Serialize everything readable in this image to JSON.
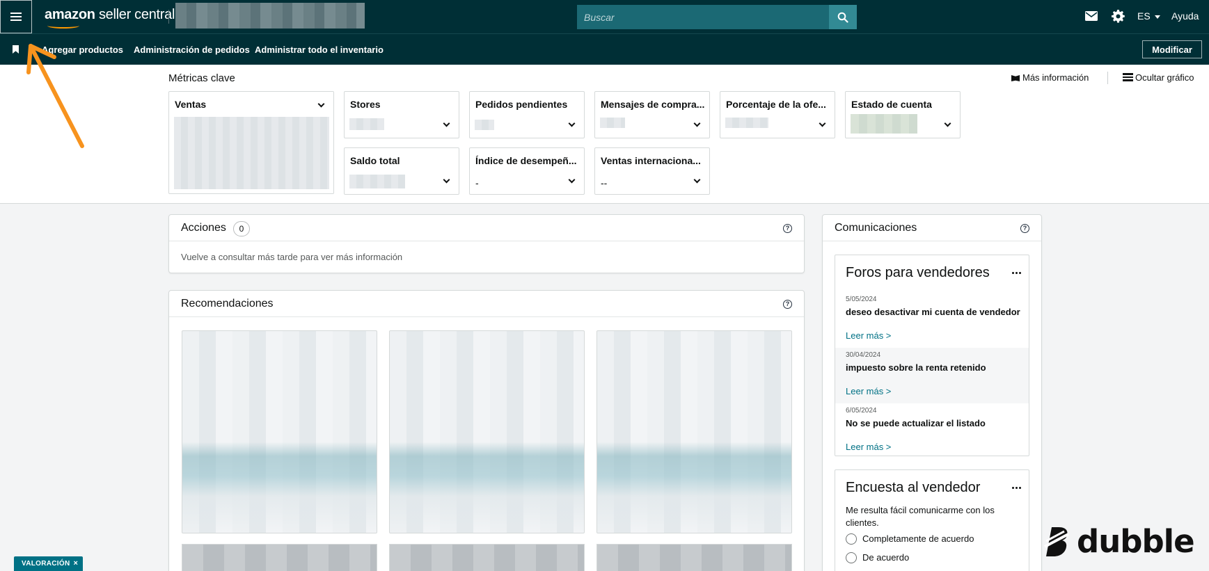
{
  "header": {
    "logo_brand": "amazon",
    "logo_product": "seller central",
    "search_placeholder": "Buscar",
    "language": "ES",
    "help": "Ayuda",
    "icons": [
      "menu-icon",
      "search-icon",
      "mail-icon",
      "gear-icon"
    ]
  },
  "nav": {
    "items": [
      "Agregar productos",
      "Administración de pedidos",
      "Administrar todo el inventario"
    ],
    "modify_label": "Modificar"
  },
  "metrics": {
    "title": "Métricas clave",
    "more_info": "Más información",
    "hide_chart": "Ocultar gráfico",
    "cards": [
      {
        "label": "Ventas"
      },
      {
        "label": "Stores"
      },
      {
        "label": "Pedidos pendientes"
      },
      {
        "label": "Mensajes de compra..."
      },
      {
        "label": "Porcentaje de la ofe..."
      },
      {
        "label": "Estado de cuenta"
      },
      {
        "label": "Saldo total"
      },
      {
        "label": "Índice de desempeñ...",
        "value": "-"
      },
      {
        "label": "Ventas internaciona...",
        "value": "--"
      }
    ]
  },
  "actions": {
    "title": "Acciones",
    "count": "0",
    "message": "Vuelve a consultar más tarde para ver más información"
  },
  "recommendations": {
    "title": "Recomendaciones"
  },
  "communications": {
    "title": "Comunicaciones",
    "forums": {
      "title": "Foros para vendedores",
      "posts": [
        {
          "date": "5/05/2024",
          "title": "deseo desactivar mi cuenta de vendedor",
          "read_more": "Leer más >"
        },
        {
          "date": "30/04/2024",
          "title": "impuesto sobre la renta retenido",
          "read_more": "Leer más >"
        },
        {
          "date": "6/05/2024",
          "title": "No se puede actualizar el listado",
          "read_more": "Leer más >"
        }
      ]
    },
    "survey": {
      "title": "Encuesta al vendedor",
      "question": "Me resulta fácil comunicarme con los clientes.",
      "options": [
        "Completamente de acuerdo",
        "De acuerdo"
      ]
    }
  },
  "overlays": {
    "feedback_tab": "VALORACIÓN",
    "feedback_close": "×",
    "watermark": "dubble",
    "annotation_color": "#f7931e"
  },
  "colors": {
    "header_bg": "#002f36",
    "search_bg": "#1b6974",
    "search_button": "#328a94",
    "link": "#007185"
  }
}
